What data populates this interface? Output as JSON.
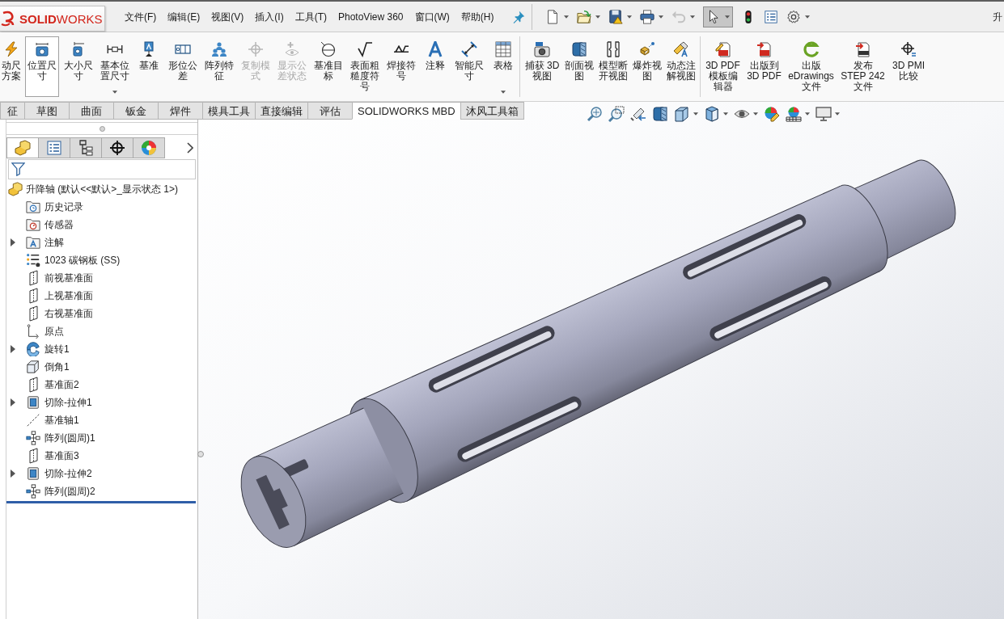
{
  "title_bar": {
    "logo": "**SOLID**WORKS",
    "document_title": "升"
  },
  "menu": [
    {
      "label": "文件(F)"
    },
    {
      "label": "编辑(E)"
    },
    {
      "label": "视图(V)"
    },
    {
      "label": "插入(I)"
    },
    {
      "label": "工具(T)"
    },
    {
      "label": "PhotoView 360"
    },
    {
      "label": "窗口(W)"
    },
    {
      "label": "帮助(H)"
    }
  ],
  "quick_toolbar": [
    {
      "dropdown": true,
      "disabled": false,
      "pressed": false
    },
    {
      "dropdown": true,
      "disabled": false,
      "pressed": false
    },
    {
      "dropdown": true,
      "disabled": false,
      "pressed": false
    },
    {
      "dropdown": true,
      "disabled": false,
      "pressed": false
    },
    {
      "dropdown": true,
      "disabled": true,
      "pressed": false
    },
    {
      "dropdown": true,
      "disabled": false,
      "pressed": true
    },
    {
      "dropdown": false,
      "disabled": false,
      "pressed": false
    },
    {
      "dropdown": false,
      "disabled": false,
      "pressed": false
    },
    {
      "dropdown": true,
      "disabled": false,
      "pressed": false
    }
  ],
  "ribbon": {
    "groups": [
      {
        "items": [
          {
            "label": "动尺方案",
            "selected": false,
            "disabled": false,
            "dropdown": false
          },
          {
            "label": "位置尺寸",
            "selected": true,
            "disabled": false,
            "dropdown": false
          },
          {
            "label": "大小尺寸",
            "selected": false,
            "disabled": false,
            "dropdown": false
          },
          {
            "label": "基本位置尺寸",
            "selected": false,
            "disabled": false,
            "dropdown": true
          },
          {
            "label": "基准",
            "selected": false,
            "disabled": false,
            "dropdown": false
          },
          {
            "label": "形位公差",
            "selected": false,
            "disabled": false,
            "dropdown": false
          },
          {
            "label": "阵列特征",
            "selected": false,
            "disabled": false,
            "dropdown": false
          },
          {
            "label": "复制模式",
            "selected": false,
            "disabled": true,
            "dropdown": false
          },
          {
            "label": "显示公差状态",
            "selected": false,
            "disabled": true,
            "dropdown": false
          },
          {
            "label": "基准目标",
            "selected": false,
            "disabled": false,
            "dropdown": false
          },
          {
            "label": "表面粗糙度符号",
            "selected": false,
            "disabled": false,
            "dropdown": false
          },
          {
            "label": "焊接符号",
            "selected": false,
            "disabled": false,
            "dropdown": false
          },
          {
            "label": "注释",
            "selected": false,
            "disabled": false,
            "dropdown": false
          },
          {
            "label": "智能尺寸",
            "selected": false,
            "disabled": false,
            "dropdown": false
          },
          {
            "label": "表格",
            "selected": false,
            "disabled": false,
            "dropdown": true
          }
        ]
      },
      {
        "items": [
          {
            "label": "捕获 3D 视图",
            "selected": false,
            "disabled": false,
            "dropdown": false
          },
          {
            "label": "剖面视图",
            "selected": false,
            "disabled": false,
            "dropdown": false
          },
          {
            "label": "模型断开视图",
            "selected": false,
            "disabled": false,
            "dropdown": false
          },
          {
            "label": "爆炸视图",
            "selected": false,
            "disabled": false,
            "dropdown": false
          },
          {
            "label": "动态注解视图",
            "selected": false,
            "disabled": false,
            "dropdown": false
          }
        ]
      },
      {
        "items": [
          {
            "label": "3D PDF 模板编辑器",
            "selected": false,
            "disabled": false,
            "dropdown": false
          },
          {
            "label": "出版到 3D PDF",
            "selected": false,
            "disabled": false,
            "dropdown": false
          },
          {
            "label": "出版 eDrawings 文件",
            "selected": false,
            "disabled": false,
            "dropdown": false
          },
          {
            "label": "发布 STEP 242 文件",
            "selected": false,
            "disabled": false,
            "dropdown": false
          },
          {
            "label": "3D PMI 比较",
            "selected": false,
            "disabled": false,
            "dropdown": false
          }
        ]
      }
    ]
  },
  "command_tabs": [
    {
      "label": "征",
      "selected": false
    },
    {
      "label": "草图",
      "selected": false
    },
    {
      "label": "曲面",
      "selected": false
    },
    {
      "label": "钣金",
      "selected": false
    },
    {
      "label": "焊件",
      "selected": false
    },
    {
      "label": "模具工具",
      "selected": false
    },
    {
      "label": "直接编辑",
      "selected": false
    },
    {
      "label": "评估",
      "selected": false
    },
    {
      "label": "SOLIDWORKS MBD",
      "selected": true
    },
    {
      "label": "沐风工具箱",
      "selected": false
    }
  ],
  "view_toolbar": [
    {
      "dropdown": false
    },
    {
      "dropdown": false
    },
    {
      "dropdown": false
    },
    {
      "dropdown": false
    },
    {
      "dropdown": true
    },
    {
      "dropdown": true
    },
    {
      "dropdown": true
    },
    {
      "dropdown": false
    },
    {
      "dropdown": true
    },
    {
      "dropdown": true
    }
  ],
  "feature_manager": {
    "tabs": [
      {
        "selected": true
      },
      {
        "selected": false
      },
      {
        "selected": false
      },
      {
        "selected": false
      },
      {
        "selected": false
      }
    ],
    "tree": {
      "label": "升降轴 (默认<<默认>_显示状态 1>)",
      "children": [
        {
          "label": "历史记录",
          "expandable": false
        },
        {
          "label": "传感器",
          "expandable": false
        },
        {
          "label": "注解",
          "expandable": true
        },
        {
          "label": "1023 碳钢板 (SS)",
          "expandable": false
        },
        {
          "label": "前视基准面",
          "expandable": false
        },
        {
          "label": "上视基准面",
          "expandable": false
        },
        {
          "label": "右视基准面",
          "expandable": false
        },
        {
          "label": "原点",
          "expandable": false
        },
        {
          "label": "旋转1",
          "expandable": true
        },
        {
          "label": "倒角1",
          "expandable": false
        },
        {
          "label": "基准面2",
          "expandable": false
        },
        {
          "label": "切除-拉伸1",
          "expandable": true
        },
        {
          "label": "基准轴1",
          "expandable": false
        },
        {
          "label": "阵列(圆周)1",
          "expandable": false
        },
        {
          "label": "基准面3",
          "expandable": false
        },
        {
          "label": "切除-拉伸2",
          "expandable": true
        },
        {
          "label": "阵列(圆周)2",
          "expandable": false
        }
      ]
    }
  }
}
